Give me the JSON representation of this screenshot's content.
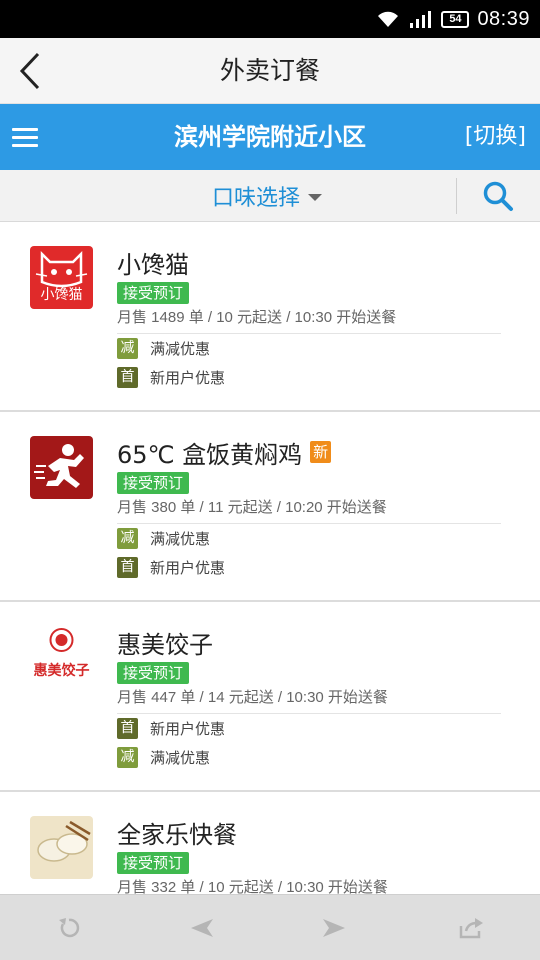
{
  "status_bar": {
    "battery": "54",
    "time": "08:39"
  },
  "header": {
    "title": "外卖订餐"
  },
  "location_bar": {
    "area": "滨州学院附近小区",
    "switch_label": "[切换]"
  },
  "filter": {
    "taste_label": "口味选择"
  },
  "restaurants": [
    {
      "name": "小馋猫",
      "badge": "",
      "logo_text": "小馋猫",
      "status": "接受预订",
      "meta": "月售 1489 单 / 10 元起送 / 10:30 开始送餐",
      "promos": [
        {
          "icon": "减",
          "text": "满减优惠"
        },
        {
          "icon": "首",
          "text": "新用户优惠"
        }
      ]
    },
    {
      "name": "65℃ 盒饭黄焖鸡",
      "badge": "新",
      "status": "接受预订",
      "meta": "月售 380 单 / 11 元起送 / 10:20 开始送餐",
      "promos": [
        {
          "icon": "减",
          "text": "满减优惠"
        },
        {
          "icon": "首",
          "text": "新用户优惠"
        }
      ]
    },
    {
      "name": "惠美饺子",
      "badge": "",
      "logo_text": "惠美饺子",
      "status": "接受预订",
      "meta": "月售 447 单 / 14 元起送 / 10:30 开始送餐",
      "promos": [
        {
          "icon": "首",
          "text": "新用户优惠"
        },
        {
          "icon": "减",
          "text": "满减优惠"
        }
      ]
    },
    {
      "name": "全家乐快餐",
      "badge": "",
      "status": "接受预订",
      "meta": "月售 332 单 / 10 元起送 / 10:30 开始送餐",
      "promos": []
    }
  ],
  "colors": {
    "brand_blue": "#2d9ae4",
    "accept_green": "#3fb94f",
    "new_orange": "#f08c1a"
  },
  "icons": {
    "back": "chevron-left-icon",
    "menu": "hamburger-menu-icon",
    "search": "search-icon",
    "refresh": "refresh-icon",
    "prev": "arrow-left-icon",
    "next": "arrow-right-icon",
    "share": "share-icon"
  }
}
